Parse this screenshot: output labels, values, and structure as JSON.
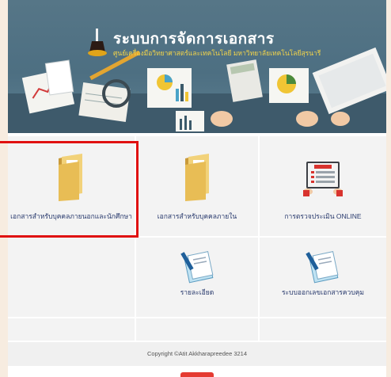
{
  "header": {
    "title": "ระบบการจัดการเอกสาร",
    "subtitle": "ศูนย์เครื่องมือวิทยาศาสตร์และเทคโนโลยี มหาวิทยาลัยเทคโนโลยีสุรนารี"
  },
  "menu": {
    "items": [
      {
        "label": "เอกสารสำหรับบุคคลภายนอกและนักศึกษา",
        "icon": "folder-icon",
        "selected": true
      },
      {
        "label": "เอกสารสำหรับบุคคลภายใน",
        "icon": "folder-icon",
        "selected": false
      },
      {
        "label": "การตรวจประเมิน ONLINE",
        "icon": "online-test-icon",
        "selected": false
      },
      {
        "label": "รายละเอียด",
        "icon": "document-pen-icon",
        "selected": false
      },
      {
        "label": "ระบบออกเลขเอกสารควบคุม",
        "icon": "document-pen-icon",
        "selected": false
      }
    ]
  },
  "footer": {
    "copyright": "Copyright ©Atit Akkharapreedee 3214"
  },
  "colors": {
    "highlight": "#e01010",
    "arrow": "#e8412c",
    "label_text": "#2a3b6e",
    "banner_bg": "#567687"
  }
}
